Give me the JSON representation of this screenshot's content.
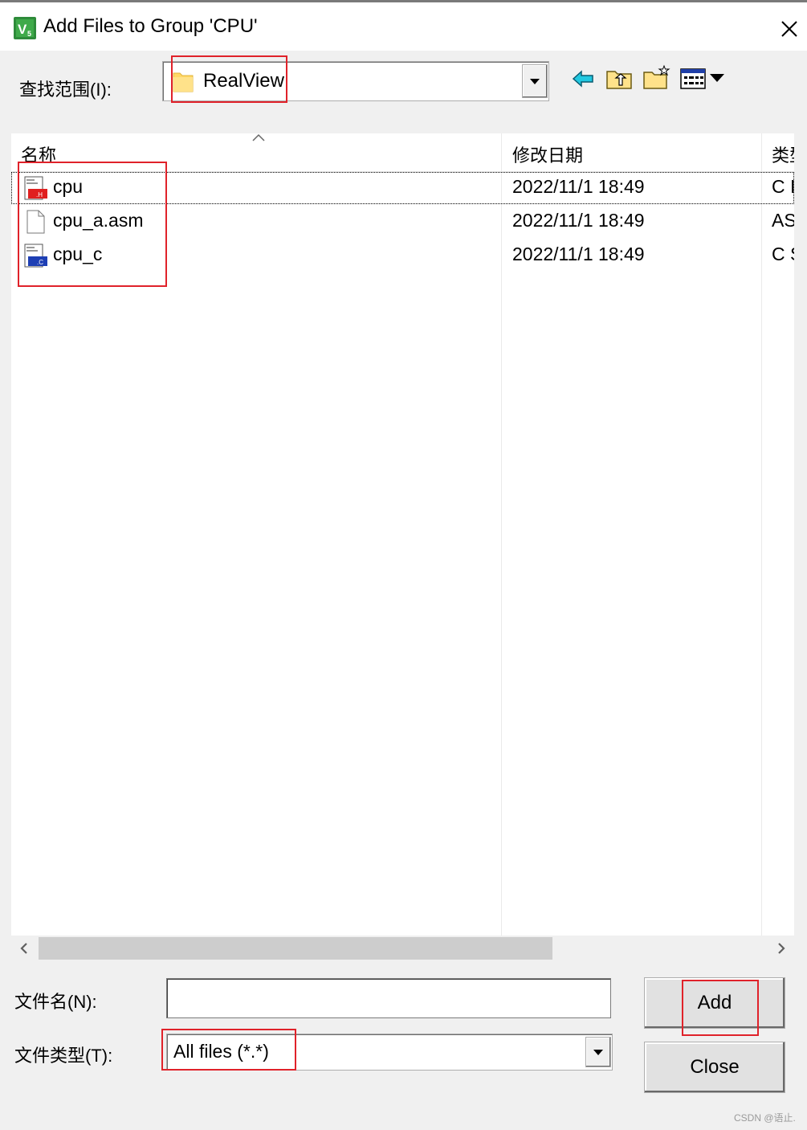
{
  "window": {
    "title": "Add Files to Group 'CPU'"
  },
  "icons": {
    "app": "keil-uvision-icon",
    "close": "close-icon",
    "back": "back-arrow-icon",
    "up": "up-folder-icon",
    "new_folder": "new-folder-icon",
    "view": "view-menu-icon",
    "folder": "folder-icon"
  },
  "lookin": {
    "label": "查找范围(I):",
    "value": "RealView"
  },
  "columns": {
    "name": "名称",
    "date": "修改日期",
    "type": "类型"
  },
  "files": [
    {
      "name": "cpu",
      "date": "2022/11/1 18:49",
      "type": "C I",
      "icon": "header-file-icon"
    },
    {
      "name": "cpu_a.asm",
      "date": "2022/11/1 18:49",
      "type": "AS",
      "icon": "blank-file-icon"
    },
    {
      "name": "cpu_c",
      "date": "2022/11/1 18:49",
      "type": "C S",
      "icon": "c-source-file-icon"
    }
  ],
  "filename": {
    "label": "文件名(N):",
    "value": ""
  },
  "filetype": {
    "label": "文件类型(T):",
    "value": "All files (*.*)"
  },
  "buttons": {
    "add": "Add",
    "close": "Close"
  },
  "watermark": "CSDN @语止.",
  "colors": {
    "highlight": "#e0222a"
  }
}
